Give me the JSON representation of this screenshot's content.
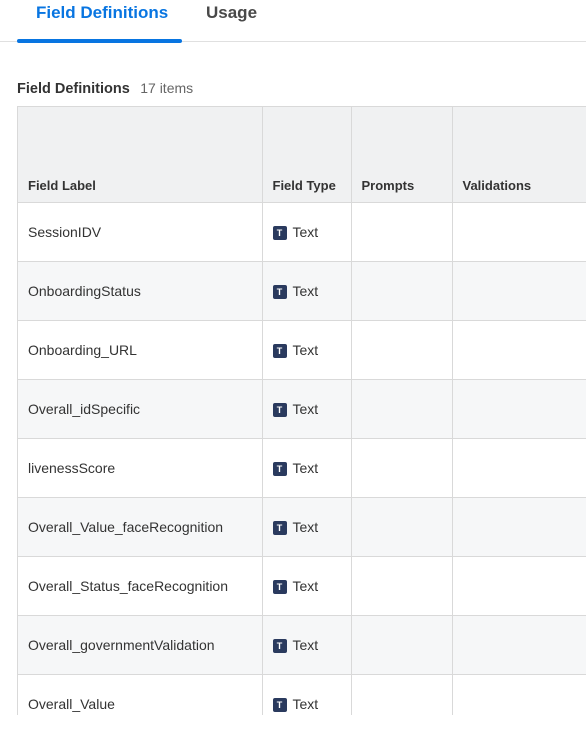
{
  "tabs": [
    {
      "label": "Field Definitions",
      "active": true
    },
    {
      "label": "Usage",
      "active": false
    }
  ],
  "section": {
    "title": "Field Definitions",
    "count": "17 items"
  },
  "table": {
    "columns": [
      "Field Label",
      "Field Type",
      "Prompts",
      "Validations"
    ],
    "type_icon_letter": "T",
    "rows": [
      {
        "label": "SessionIDV",
        "type": "Text",
        "prompts": "",
        "validations": ""
      },
      {
        "label": "OnboardingStatus",
        "type": "Text",
        "prompts": "",
        "validations": ""
      },
      {
        "label": "Onboarding_URL",
        "type": "Text",
        "prompts": "",
        "validations": ""
      },
      {
        "label": "Overall_idSpecific",
        "type": "Text",
        "prompts": "",
        "validations": ""
      },
      {
        "label": "livenessScore",
        "type": "Text",
        "prompts": "",
        "validations": ""
      },
      {
        "label": "Overall_Value_faceRecognition",
        "type": "Text",
        "prompts": "",
        "validations": ""
      },
      {
        "label": "Overall_Status_faceRecognition",
        "type": "Text",
        "prompts": "",
        "validations": ""
      },
      {
        "label": "Overall_governmentValidation",
        "type": "Text",
        "prompts": "",
        "validations": ""
      },
      {
        "label": "Overall_Value",
        "type": "Text",
        "prompts": "",
        "validations": ""
      }
    ]
  },
  "colors": {
    "accent": "#0875e1",
    "type_icon_bg": "#2a3a5e",
    "header_bg": "#f0f1f2",
    "alt_row_bg": "#f6f7f8"
  }
}
